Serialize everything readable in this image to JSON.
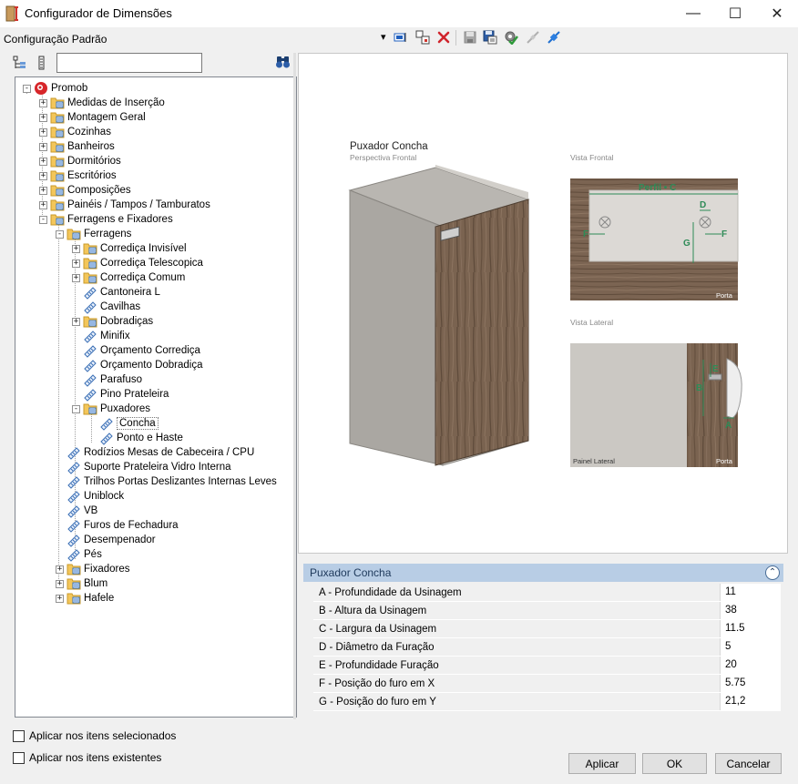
{
  "window": {
    "title": "Configurador de Dimensões",
    "minimize": "—",
    "maximize": "☐",
    "close": "✕"
  },
  "toolbar": {
    "config_label": "Configuração Padrão",
    "dropdown_arrow": "▾"
  },
  "tree": {
    "search_value": "",
    "items": [
      {
        "label": "Promob"
      },
      {
        "label": "Medidas de Inserção"
      },
      {
        "label": "Montagem Geral"
      },
      {
        "label": "Cozinhas"
      },
      {
        "label": "Banheiros"
      },
      {
        "label": "Dormitórios"
      },
      {
        "label": "Escritórios"
      },
      {
        "label": "Composições"
      },
      {
        "label": "Painéis / Tampos / Tamburatos"
      },
      {
        "label": "Ferragens e Fixadores"
      },
      {
        "label": "Ferragens"
      },
      {
        "label": "Corrediça Invisível"
      },
      {
        "label": "Corrediça Telescopica"
      },
      {
        "label": "Corrediça Comum"
      },
      {
        "label": "Cantoneira L"
      },
      {
        "label": "Cavilhas"
      },
      {
        "label": "Dobradiças"
      },
      {
        "label": "Minifix"
      },
      {
        "label": "Orçamento Corrediça"
      },
      {
        "label": "Orçamento Dobradiça"
      },
      {
        "label": "Parafuso"
      },
      {
        "label": "Pino Prateleira"
      },
      {
        "label": "Puxadores"
      },
      {
        "label": "Concha"
      },
      {
        "label": "Ponto e Haste"
      },
      {
        "label": "Rodízios Mesas de Cabeceira / CPU"
      },
      {
        "label": "Suporte Prateleira Vidro Interna"
      },
      {
        "label": "Trilhos Portas Deslizantes Internas Leves"
      },
      {
        "label": "Uniblock"
      },
      {
        "label": "VB"
      },
      {
        "label": "Furos de Fechadura"
      },
      {
        "label": "Desempenador"
      },
      {
        "label": "Pés"
      },
      {
        "label": "Fixadores"
      },
      {
        "label": "Blum"
      },
      {
        "label": "Hafele"
      }
    ]
  },
  "preview": {
    "title": "Puxador Concha",
    "subtitle": "Perspectiva Frontal",
    "front_view_label": "Vista Frontal",
    "side_view_label": "Vista Lateral",
    "front_door_tag": "Porta",
    "side_panel_tag": "Painel Lateral",
    "side_door_tag": "Porta",
    "perfil_label": "Perfil • C",
    "dim_d": "D",
    "dim_f_left": "F",
    "dim_f_right": "F",
    "dim_g": "G",
    "dim_e": "E",
    "dim_b": "B",
    "dim_a": "A"
  },
  "properties": {
    "header": "Puxador Concha",
    "collapse_icon": "⌃",
    "rows": [
      {
        "name": "A - Profundidade da Usinagem",
        "value": "11"
      },
      {
        "name": "B - Altura da Usinagem",
        "value": "38"
      },
      {
        "name": "C - Largura da Usinagem",
        "value": "11.5"
      },
      {
        "name": "D - Diâmetro da Furação",
        "value": "5"
      },
      {
        "name": "E - Profundidade Furação",
        "value": "20"
      },
      {
        "name": "F - Posição do furo em X",
        "value": "5.75"
      },
      {
        "name": "G - Posição do furo em Y",
        "value": "21,2"
      }
    ]
  },
  "options": {
    "apply_selected": "Aplicar nos itens selecionados",
    "apply_existing": "Aplicar nos itens existentes"
  },
  "buttons": {
    "apply": "Aplicar",
    "ok": "OK",
    "cancel": "Cancelar"
  }
}
